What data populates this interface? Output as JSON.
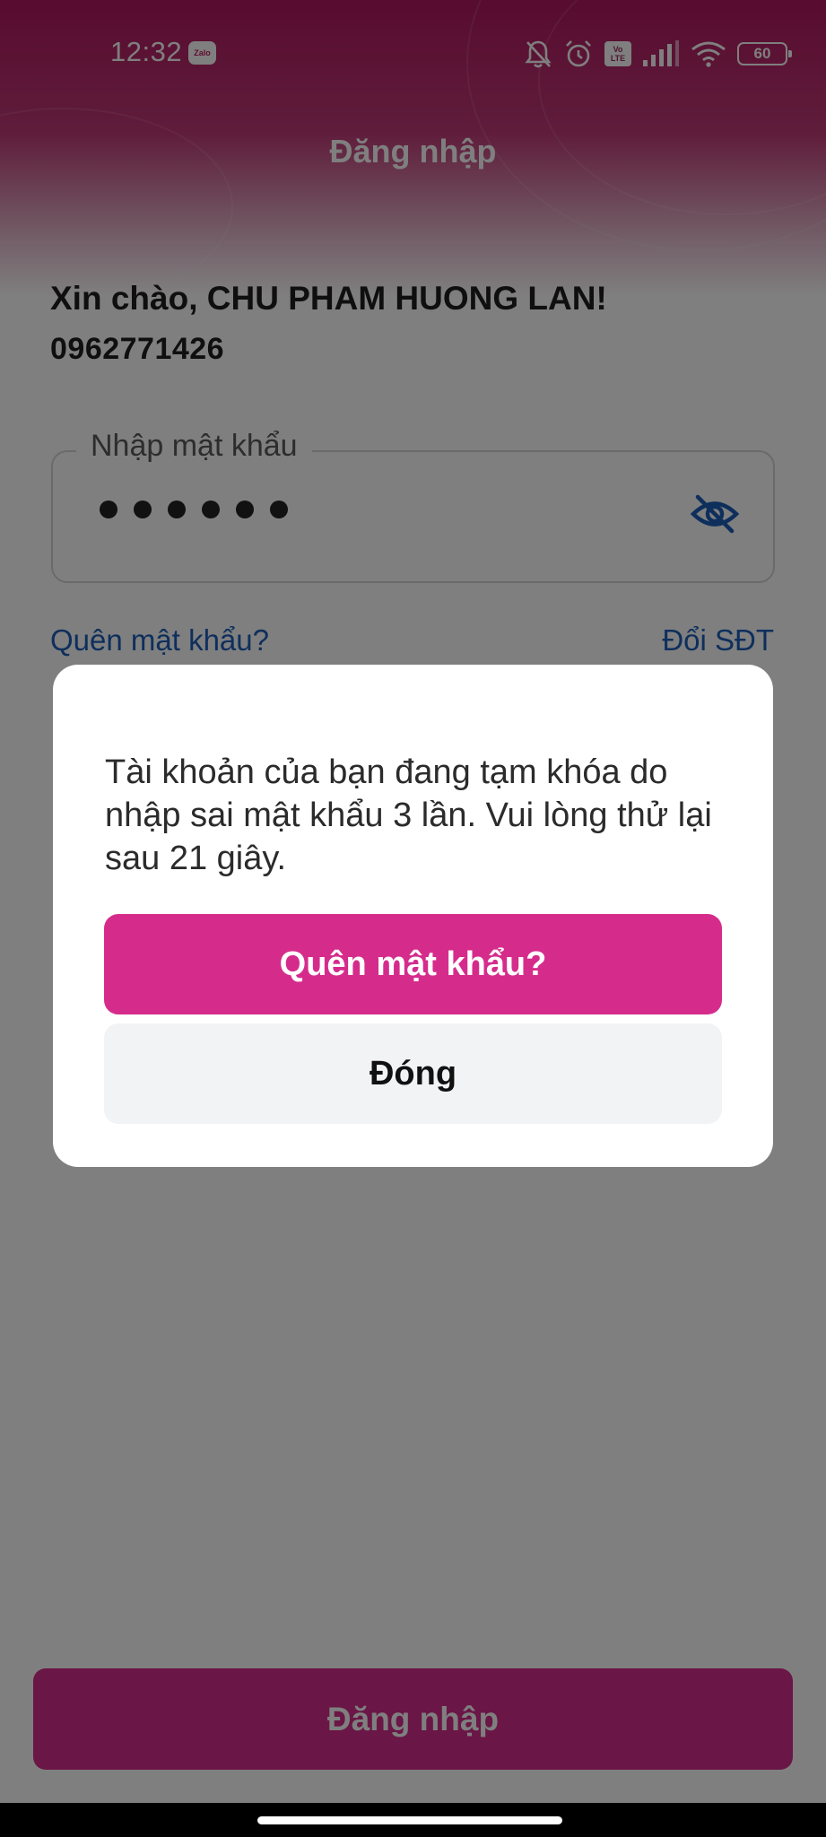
{
  "status_bar": {
    "time": "12:32",
    "notification_app": "Zalo",
    "network_badge": "Vo LTE",
    "battery_level": "60",
    "icons": [
      "bell-off-icon",
      "alarm-icon",
      "volte-icon",
      "signal-icon",
      "wifi-icon",
      "battery-icon"
    ]
  },
  "header": {
    "title": "Đăng nhập"
  },
  "user": {
    "greeting": "Xin chào, CHU PHAM HUONG LAN!",
    "phone": "0962771426"
  },
  "password_field": {
    "label": "Nhập mật khẩu",
    "masked_length": 6,
    "toggle_icon": "eye-off-icon"
  },
  "links": {
    "forgot_password": "Quên mật khẩu?",
    "change_phone": "Đổi SĐT"
  },
  "login_button": {
    "label": "Đăng nhập"
  },
  "dialog": {
    "message": "Tài khoản của bạn đang tạm khóa do nhập sai mật khẩu 3 lần. Vui lòng thử lại sau 21 giây.",
    "primary_label": "Quên mật khẩu?",
    "secondary_label": "Đóng"
  },
  "colors": {
    "brand_pink": "#d52c8c",
    "header_magenta": "#b0185f",
    "link_blue": "#1d5fb9"
  }
}
